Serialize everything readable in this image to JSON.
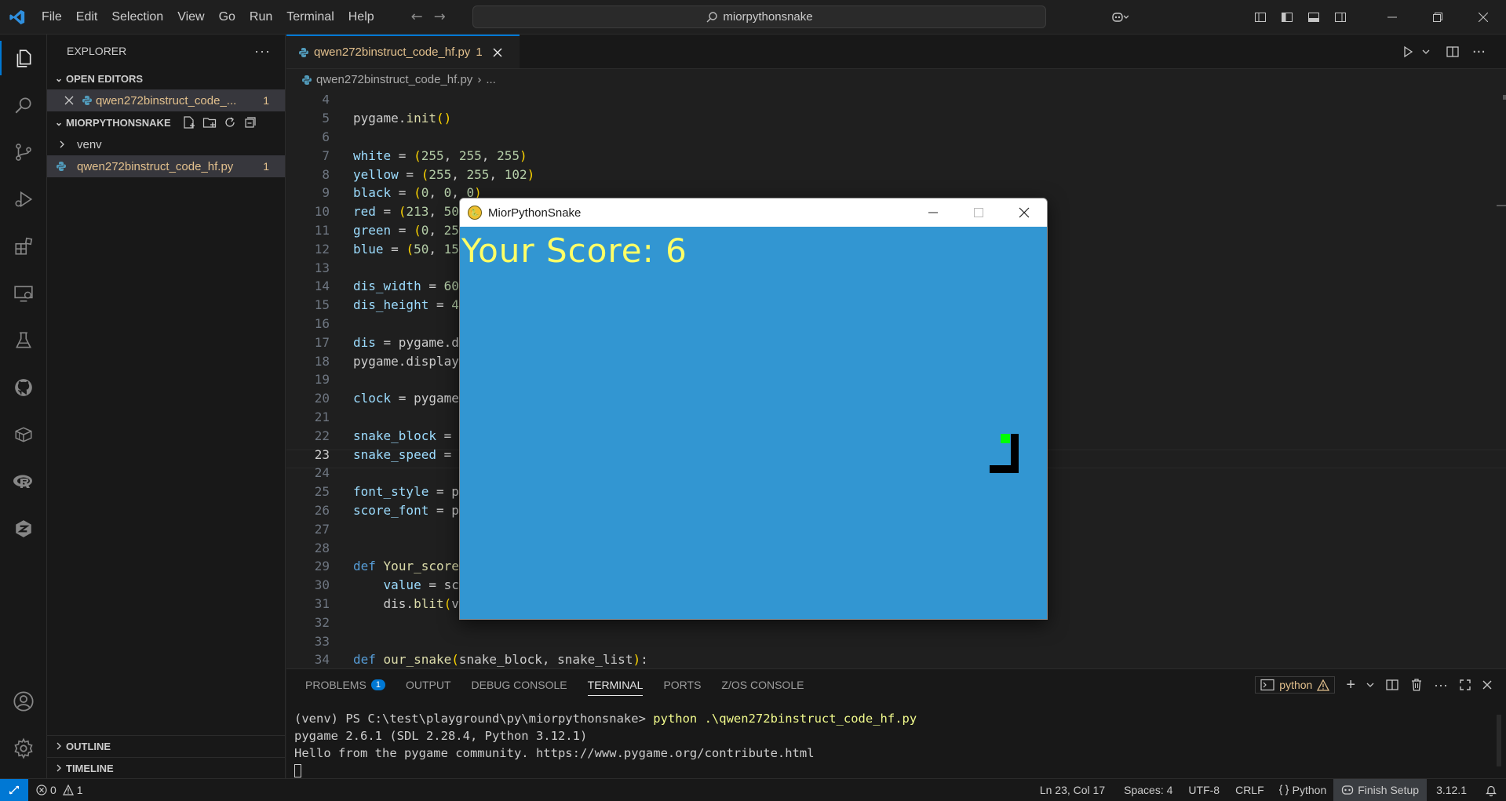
{
  "menu": [
    "File",
    "Edit",
    "Selection",
    "View",
    "Go",
    "Run",
    "Terminal",
    "Help"
  ],
  "command_center": "miorpythonsnake",
  "sidebar": {
    "title": "EXPLORER",
    "open_editors_label": "OPEN EDITORS",
    "open_editor_file": "qwen272binstruct_code_...",
    "open_editor_badge": "1",
    "project_label": "MIORPYTHONSNAKE",
    "folder_venv": "venv",
    "file": "qwen272binstruct_code_hf.py",
    "file_badge": "1",
    "outline_label": "OUTLINE",
    "timeline_label": "TIMELINE"
  },
  "editor": {
    "tab_label": "qwen272binstruct_code_hf.py",
    "tab_badge": "1",
    "breadcrumb_file": "qwen272binstruct_code_hf.py",
    "breadcrumb_more": "..."
  },
  "code_lines": [
    {
      "n": "4",
      "t": ""
    },
    {
      "n": "5",
      "t": "pygame.init()"
    },
    {
      "n": "6",
      "t": ""
    },
    {
      "n": "7",
      "t": "white = (255, 255, 255)"
    },
    {
      "n": "8",
      "t": "yellow = (255, 255, 102)"
    },
    {
      "n": "9",
      "t": "black = (0, 0, 0)"
    },
    {
      "n": "10",
      "t": "red = (213, 50"
    },
    {
      "n": "11",
      "t": "green = (0, 25"
    },
    {
      "n": "12",
      "t": "blue = (50, 15"
    },
    {
      "n": "13",
      "t": ""
    },
    {
      "n": "14",
      "t": "dis_width = 60"
    },
    {
      "n": "15",
      "t": "dis_height = 4"
    },
    {
      "n": "16",
      "t": ""
    },
    {
      "n": "17",
      "t": "dis = pygame.d"
    },
    {
      "n": "18",
      "t": "pygame.display"
    },
    {
      "n": "19",
      "t": ""
    },
    {
      "n": "20",
      "t": "clock = pygame"
    },
    {
      "n": "21",
      "t": ""
    },
    {
      "n": "22",
      "t": "snake_block = "
    },
    {
      "n": "23",
      "t": "snake_speed = "
    },
    {
      "n": "24",
      "t": ""
    },
    {
      "n": "25",
      "t": "font_style = p"
    },
    {
      "n": "26",
      "t": "score_font = p"
    },
    {
      "n": "27",
      "t": ""
    },
    {
      "n": "28",
      "t": ""
    },
    {
      "n": "29",
      "t": "def Your_score"
    },
    {
      "n": "30",
      "t": "    value = sc"
    },
    {
      "n": "31",
      "t": "    dis.blit(v"
    },
    {
      "n": "32",
      "t": ""
    },
    {
      "n": "33",
      "t": ""
    },
    {
      "n": "34",
      "t": "def our_snake(snake_block, snake_list):"
    }
  ],
  "panel": {
    "tabs": [
      "PROBLEMS",
      "OUTPUT",
      "DEBUG CONSOLE",
      "TERMINAL",
      "PORTS",
      "Z/OS CONSOLE"
    ],
    "problems_badge": "1",
    "terminal_name": "python",
    "terminal_lines": {
      "prompt": "(venv) PS C:\\test\\playground\\py\\miorpythonsnake> ",
      "command": "python .\\qwen272binstruct_code_hf.py",
      "line2": "pygame 2.6.1 (SDL 2.28.4, Python 3.12.1)",
      "line3": "Hello from the pygame community. https://www.pygame.org/contribute.html"
    }
  },
  "statusbar": {
    "errors": "0",
    "warnings": "1",
    "position": "Ln 23, Col 17",
    "spaces": "Spaces: 4",
    "encoding": "UTF-8",
    "eol": "CRLF",
    "language": "Python",
    "finish_setup": "Finish Setup",
    "version": "3.12.1"
  },
  "pygame_window": {
    "title": "MiorPythonSnake",
    "score_text": "Your Score: 6",
    "background_color": "#3296d2",
    "score_color": "#ffff66",
    "snake_color": "#000000",
    "food_color": "#00ff00"
  },
  "colors": {
    "accent": "#0078d4",
    "modified": "#e2c08d"
  }
}
